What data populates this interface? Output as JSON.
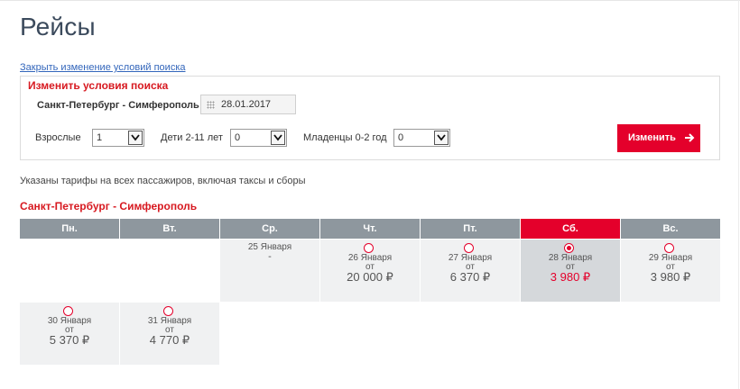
{
  "page": {
    "title": "Рейсы"
  },
  "search": {
    "close_link": "Закрыть изменение условий поиска",
    "panel_title": "Изменить условия поиска",
    "route": "Санкт-Петербург - Симферополь",
    "date": "28.01.2017",
    "adults_label": "Взрослые",
    "adults_value": "1",
    "children_label": "Дети 2-11 лет",
    "children_value": "0",
    "infants_label": "Младенцы 0-2 год",
    "infants_value": "0",
    "submit_label": "Изменить"
  },
  "note": "Указаны тарифы на всех пассажиров, включая таксы и сборы",
  "results": {
    "route_title": "Санкт-Петербург - Симферополь",
    "weekdays": [
      "Пн.",
      "Вт.",
      "Ср.",
      "Чт.",
      "Пт.",
      "Сб.",
      "Вс."
    ],
    "from_label": "от",
    "days": [
      {
        "date": "25 Января",
        "price": "-"
      },
      {
        "date": "26 Января",
        "price": "20 000 ₽"
      },
      {
        "date": "27 Января",
        "price": "6 370 ₽"
      },
      {
        "date": "28 Января",
        "price": "3 980 ₽",
        "selected": true
      },
      {
        "date": "29 Января",
        "price": "3 980 ₽"
      },
      {
        "date": "30 Января",
        "price": "5 370 ₽"
      },
      {
        "date": "31 Января",
        "price": "4 770 ₽"
      }
    ]
  },
  "colors": {
    "accent": "#e4002b",
    "header_gray": "#8e979e",
    "link": "#3366bb"
  }
}
